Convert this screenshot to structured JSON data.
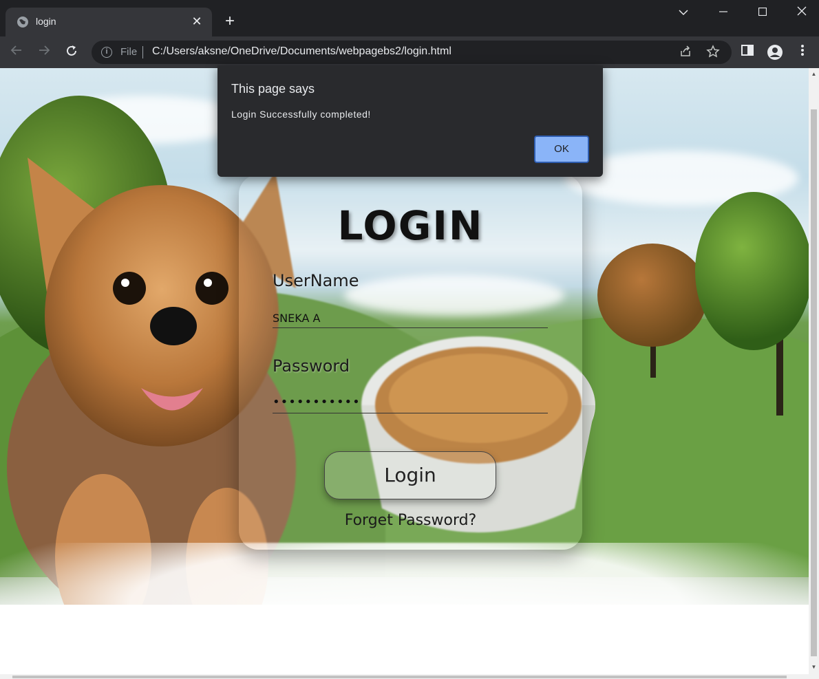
{
  "browser": {
    "tab_title": "login",
    "tab_close": "✕",
    "new_tab": "+",
    "scheme_label": "File",
    "url": "C:/Users/aksne/OneDrive/Documents/webpagebs2/login.html",
    "icons": {
      "back": "back-arrow-icon",
      "forward": "forward-arrow-icon",
      "reload": "reload-icon",
      "info": "info-icon",
      "share": "share-icon",
      "bookmark": "star-icon",
      "side_panel": "side-panel-icon",
      "profile": "profile-icon",
      "menu": "kebab-menu-icon"
    }
  },
  "page": {
    "heading": "LOGIN",
    "username_label": "UserName",
    "username_value": "SNEKA A",
    "password_label": "Password",
    "password_value": "•••••••••••",
    "login_button": "Login",
    "forget_link": "Forget Password?"
  },
  "dialog": {
    "title": "This page says",
    "message": "Login Successfully completed!",
    "ok_button": "OK"
  },
  "colors": {
    "chrome_bg": "#202124",
    "toolbar_bg": "#35363a",
    "dialog_bg": "#292a2d",
    "ok_button": "#8ab4f8"
  }
}
